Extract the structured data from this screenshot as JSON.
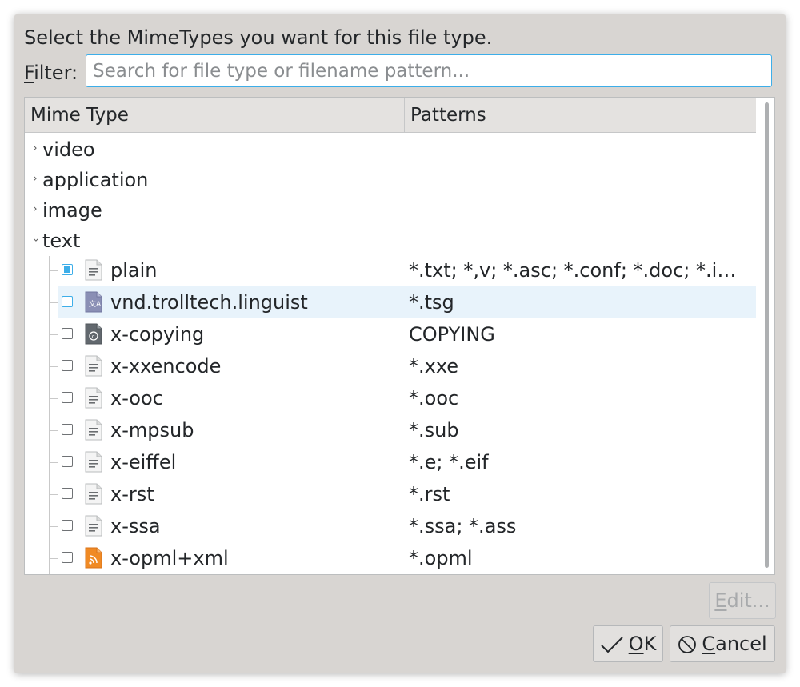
{
  "dialog": {
    "prompt": "Select the MimeTypes you want for this file type.",
    "filter_label_accel": "F",
    "filter_label_rest": "ilter:",
    "filter_placeholder": "Search for file type or filename pattern...",
    "filter_value": ""
  },
  "table": {
    "headers": {
      "mime": "Mime Type",
      "patterns": "Patterns"
    },
    "categories": [
      {
        "label": "video",
        "expanded": false
      },
      {
        "label": "application",
        "expanded": false
      },
      {
        "label": "image",
        "expanded": false
      },
      {
        "label": "text",
        "expanded": true
      }
    ],
    "rows": [
      {
        "name": "plain",
        "patterns": "*.txt; *,v; *.asc; *.conf; *.doc; *.id…",
        "checked": true,
        "icon": "text-file-icon"
      },
      {
        "name": "vnd.trolltech.linguist",
        "patterns": "*.tsg",
        "checked": false,
        "icon": "translation-file-icon"
      },
      {
        "name": "x-copying",
        "patterns": "COPYING",
        "checked": false,
        "icon": "copyright-file-icon"
      },
      {
        "name": "x-xxencode",
        "patterns": "*.xxe",
        "checked": false,
        "icon": "text-file-icon"
      },
      {
        "name": "x-ooc",
        "patterns": "*.ooc",
        "checked": false,
        "icon": "text-file-icon"
      },
      {
        "name": "x-mpsub",
        "patterns": "*.sub",
        "checked": false,
        "icon": "text-file-icon"
      },
      {
        "name": "x-eiffel",
        "patterns": "*.e; *.eif",
        "checked": false,
        "icon": "text-file-icon"
      },
      {
        "name": "x-rst",
        "patterns": "*.rst",
        "checked": false,
        "icon": "text-file-icon"
      },
      {
        "name": "x-ssa",
        "patterns": "*.ssa; *.ass",
        "checked": false,
        "icon": "text-file-icon"
      },
      {
        "name": "x-opml+xml",
        "patterns": "*.opml",
        "checked": false,
        "icon": "rss-file-icon"
      }
    ]
  },
  "buttons": {
    "edit_accel": "E",
    "edit_rest": "dit...",
    "ok_accel": "O",
    "ok_rest": "K",
    "cancel_accel": "C",
    "cancel_rest": "ancel"
  },
  "colors": {
    "accent": "#3daee9",
    "window": "#d8d5d2",
    "selection": "#e8f3fb"
  }
}
